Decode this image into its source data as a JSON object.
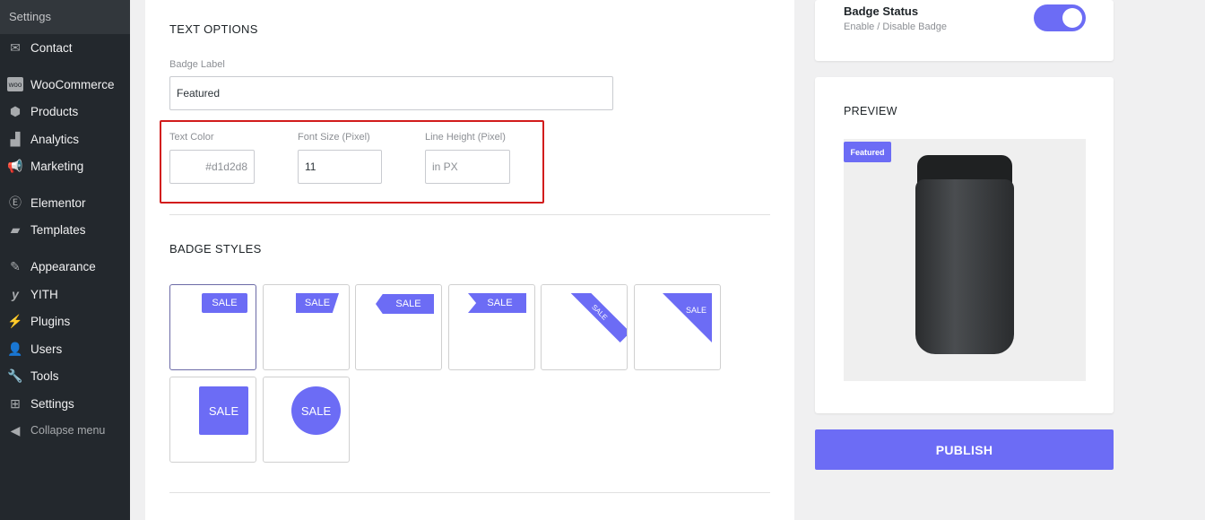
{
  "sidebar": {
    "top": "Settings",
    "items": [
      {
        "label": "Contact",
        "icon": "envelope-icon"
      },
      {
        "label": "WooCommerce",
        "icon": "woo-icon"
      },
      {
        "label": "Products",
        "icon": "box-icon"
      },
      {
        "label": "Analytics",
        "icon": "bar-chart-icon"
      },
      {
        "label": "Marketing",
        "icon": "megaphone-icon"
      },
      {
        "label": "Elementor",
        "icon": "elementor-icon"
      },
      {
        "label": "Templates",
        "icon": "folder-icon"
      },
      {
        "label": "Appearance",
        "icon": "brush-icon"
      },
      {
        "label": "YITH",
        "icon": "yith-icon"
      },
      {
        "label": "Plugins",
        "icon": "plug-icon"
      },
      {
        "label": "Users",
        "icon": "user-icon"
      },
      {
        "label": "Tools",
        "icon": "wrench-icon"
      },
      {
        "label": "Settings",
        "icon": "settings-icon"
      },
      {
        "label": "Collapse menu",
        "icon": "collapse-icon"
      }
    ]
  },
  "text_options": {
    "title": "TEXT OPTIONS",
    "badge_label": "Badge Label",
    "badge_value": "Featured",
    "text_color_label": "Text Color",
    "text_color_value": "#d1d2d8",
    "font_size_label": "Font Size (Pixel)",
    "font_size_value": "11",
    "line_height_label": "Line Height (Pixel)",
    "line_height_placeholder": "in PX"
  },
  "badge_styles": {
    "title": "BADGE STYLES",
    "sale": "SALE",
    "selected_index": 0,
    "accent": "#6c6cf5"
  },
  "status": {
    "title": "Badge Status",
    "subtitle": "Enable / Disable Badge",
    "enabled": true
  },
  "preview": {
    "title": "PREVIEW",
    "badge": "Featured"
  },
  "publish": "PUBLISH"
}
